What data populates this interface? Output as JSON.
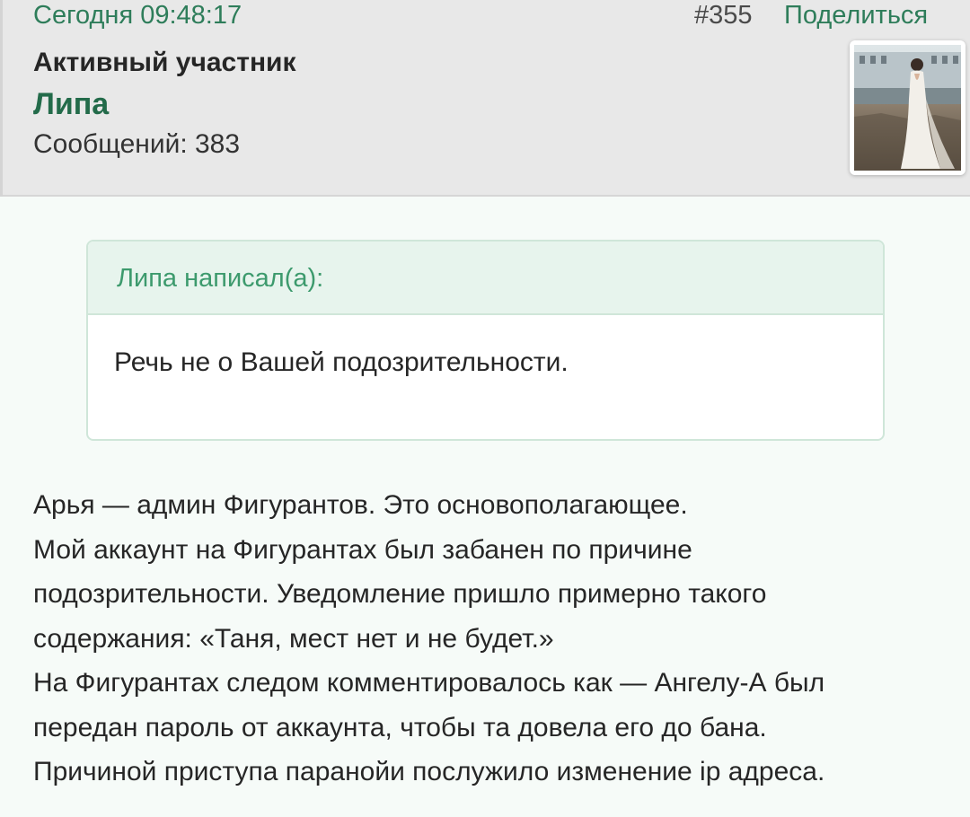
{
  "header": {
    "timestamp": "Сегодня 09:48:17",
    "post_number": "#355",
    "share_label": "Поделиться"
  },
  "author": {
    "title": "Активный участник",
    "name": "Липа",
    "message_count": "Сообщений: 383"
  },
  "quote": {
    "author_line": "Липа написал(а):",
    "text": "Речь не о Вашей подозрительности."
  },
  "body": {
    "lines": [
      "Арья — админ Фигурантов. Это основополагающее.",
      "Мой аккаунт на Фигурантах был забанен по причине",
      "подозрительности. Уведомление пришло примерно такого",
      "содержания: «Таня, мест нет и не будет.»",
      "На Фигурантах следом комментировалось как — Ангелу-А был",
      "передан пароль от аккаунта, чтобы та довела его до бана.",
      "Причиной приступа паранойи послужило изменение  ip адреса."
    ]
  },
  "colors": {
    "accent_green": "#2e7d5a",
    "username_green": "#236b4a",
    "quote_header_bg": "#e7f4ed",
    "header_bg": "#e8e8e8"
  }
}
